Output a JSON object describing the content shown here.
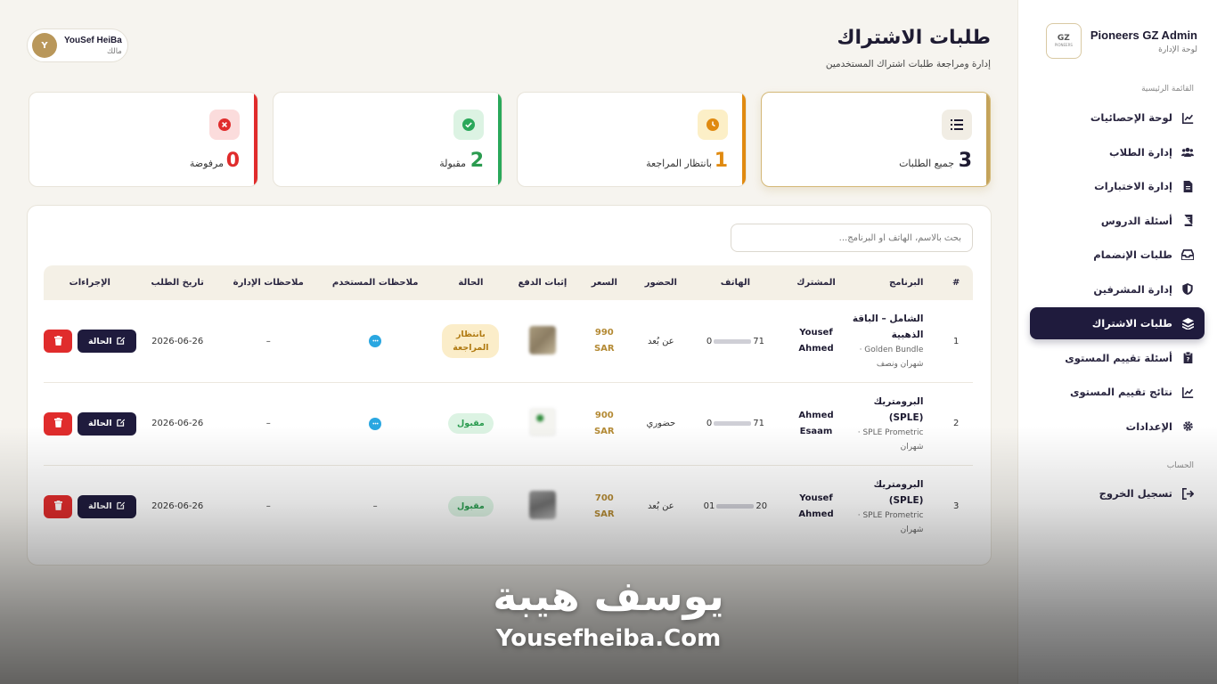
{
  "brand": {
    "title": "Pioneers GZ Admin",
    "subtitle": "لوحة الإدارة",
    "logo_text": "GZ",
    "logo_small": "PIONEERS"
  },
  "sidebar": {
    "main_label": "القائمة الرئيسية",
    "items": [
      {
        "label": "لوحة الإحصائيات",
        "icon": "chart-line-icon"
      },
      {
        "label": "إدارة الطلاب",
        "icon": "users-icon"
      },
      {
        "label": "إدارة الاختبارات",
        "icon": "file-icon"
      },
      {
        "label": "أسئلة الدروس",
        "icon": "book-icon"
      },
      {
        "label": "طلبات الإنضمام",
        "icon": "inbox-icon"
      },
      {
        "label": "إدارة المشرفين",
        "icon": "shield-icon"
      },
      {
        "label": "طلبات الاشتراك",
        "icon": "layers-icon",
        "active": true
      },
      {
        "label": "أسئلة تقييم المستوى",
        "icon": "clipboard-icon"
      },
      {
        "label": "نتائج تقييم المستوى",
        "icon": "chart-line-icon"
      },
      {
        "label": "الإعدادات",
        "icon": "gear-icon"
      }
    ],
    "account_label": "الحساب",
    "logout_label": "تسجيل الخروج"
  },
  "header": {
    "title": "طلبات الاشتراك",
    "subtitle": "إدارة ومراجعة طلبات اشتراك المستخدمين",
    "user": {
      "initial": "Y",
      "name": "YouSef HeiBa",
      "role": "مالك"
    }
  },
  "stats": [
    {
      "key": "all",
      "value": "3",
      "label": "جميع الطلبات",
      "color": "#1e1b32"
    },
    {
      "key": "pending",
      "value": "1",
      "label": "بانتظار المراجعة",
      "color": "#e08a10"
    },
    {
      "key": "accepted",
      "value": "2",
      "label": "مقبولة",
      "color": "#2a9b4f"
    },
    {
      "key": "rejected",
      "value": "0",
      "label": "مرفوضة",
      "color": "#e02c2c"
    }
  ],
  "search": {
    "placeholder": "بحث بالاسم، الهاتف أو البرنامج..."
  },
  "table": {
    "columns": [
      "#",
      "البرنامج",
      "المشترك",
      "الهاتف",
      "الحضور",
      "السعر",
      "إثبات الدفع",
      "الحالة",
      "ملاحظات المستخدم",
      "ملاحظات الإدارة",
      "تاريخ الطلب",
      "الإجراءات"
    ],
    "rows": [
      {
        "num": "1",
        "program_title": "الشامل – الباقة الذهبية",
        "program_meta": "Golden Bundle · شهران ونصف",
        "subscriber": "Yousef Ahmed",
        "phone_start": "0",
        "phone_end": "71",
        "attendance": "عن بُعد",
        "price": "990",
        "currency": "SAR",
        "status": "بانتظار المراجعة",
        "status_type": "pending",
        "user_note": "comment-icon",
        "admin_note": "–",
        "date": "2026-06-26"
      },
      {
        "num": "2",
        "program_title": "البرومتريك (SPLE)",
        "program_meta": "SPLE Prometric · شهران",
        "subscriber": "Ahmed Esaam",
        "phone_start": "0",
        "phone_end": "71",
        "attendance": "حضوري",
        "price": "900",
        "currency": "SAR",
        "status": "مقبول",
        "status_type": "ok",
        "user_note": "comment-icon",
        "admin_note": "–",
        "date": "2026-06-26"
      },
      {
        "num": "3",
        "program_title": "البرومتريك (SPLE)",
        "program_meta": "SPLE Prometric · شهران",
        "subscriber": "Yousef Ahmed",
        "phone_start": "01",
        "phone_end": "20",
        "attendance": "عن بُعد",
        "price": "700",
        "currency": "SAR",
        "status": "مقبول",
        "status_type": "ok",
        "user_note_text": "–",
        "admin_note": "–",
        "date": "2026-06-26"
      }
    ],
    "action_status_label": "الحالة"
  },
  "watermark": {
    "arabic": "يوسف هيبة",
    "english": "Yousefheiba.Com"
  }
}
